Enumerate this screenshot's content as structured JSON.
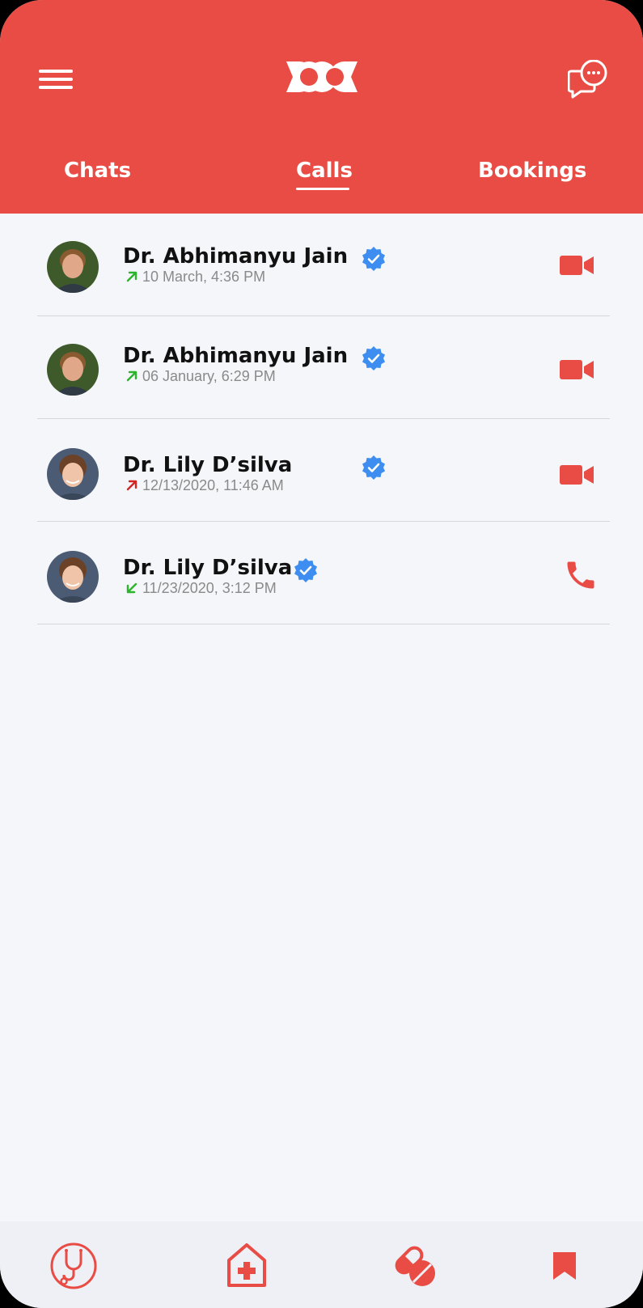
{
  "header": {
    "brand_color": "#e84c45",
    "menu_icon": "hamburger-menu-icon",
    "logo_icon": "doc-logo-icon",
    "chat_icon": "chat-bubbles-icon"
  },
  "tabs": [
    {
      "label": "Chats",
      "active": false
    },
    {
      "label": "Calls",
      "active": true
    },
    {
      "label": "Bookings",
      "active": false
    }
  ],
  "calls": [
    {
      "name": "Dr. Abhimanyu Jain",
      "time": "10 March, 4:36 PM",
      "direction": "outgoing",
      "direction_color": "#2ab52a",
      "type": "video",
      "verified": true
    },
    {
      "name": "Dr. Abhimanyu Jain",
      "time": "06 January, 6:29 PM",
      "direction": "outgoing",
      "direction_color": "#2ab52a",
      "type": "video",
      "verified": true
    },
    {
      "name": "Dr. Lily D’silva",
      "time": "12/13/2020, 11:46 AM",
      "direction": "missed",
      "direction_color": "#d42424",
      "type": "video",
      "verified": true
    },
    {
      "name": "Dr. Lily D’silva",
      "time": "11/23/2020, 3:12 PM",
      "direction": "incoming",
      "direction_color": "#2ab52a",
      "type": "voice",
      "verified": true
    }
  ],
  "colors": {
    "accent": "#e84c45",
    "verified": "#3d8ef0",
    "background": "#f5f6fa"
  },
  "bottom_nav": [
    {
      "icon": "stethoscope-icon"
    },
    {
      "icon": "hospital-home-icon"
    },
    {
      "icon": "pills-icon"
    },
    {
      "icon": "bookmark-icon"
    }
  ]
}
